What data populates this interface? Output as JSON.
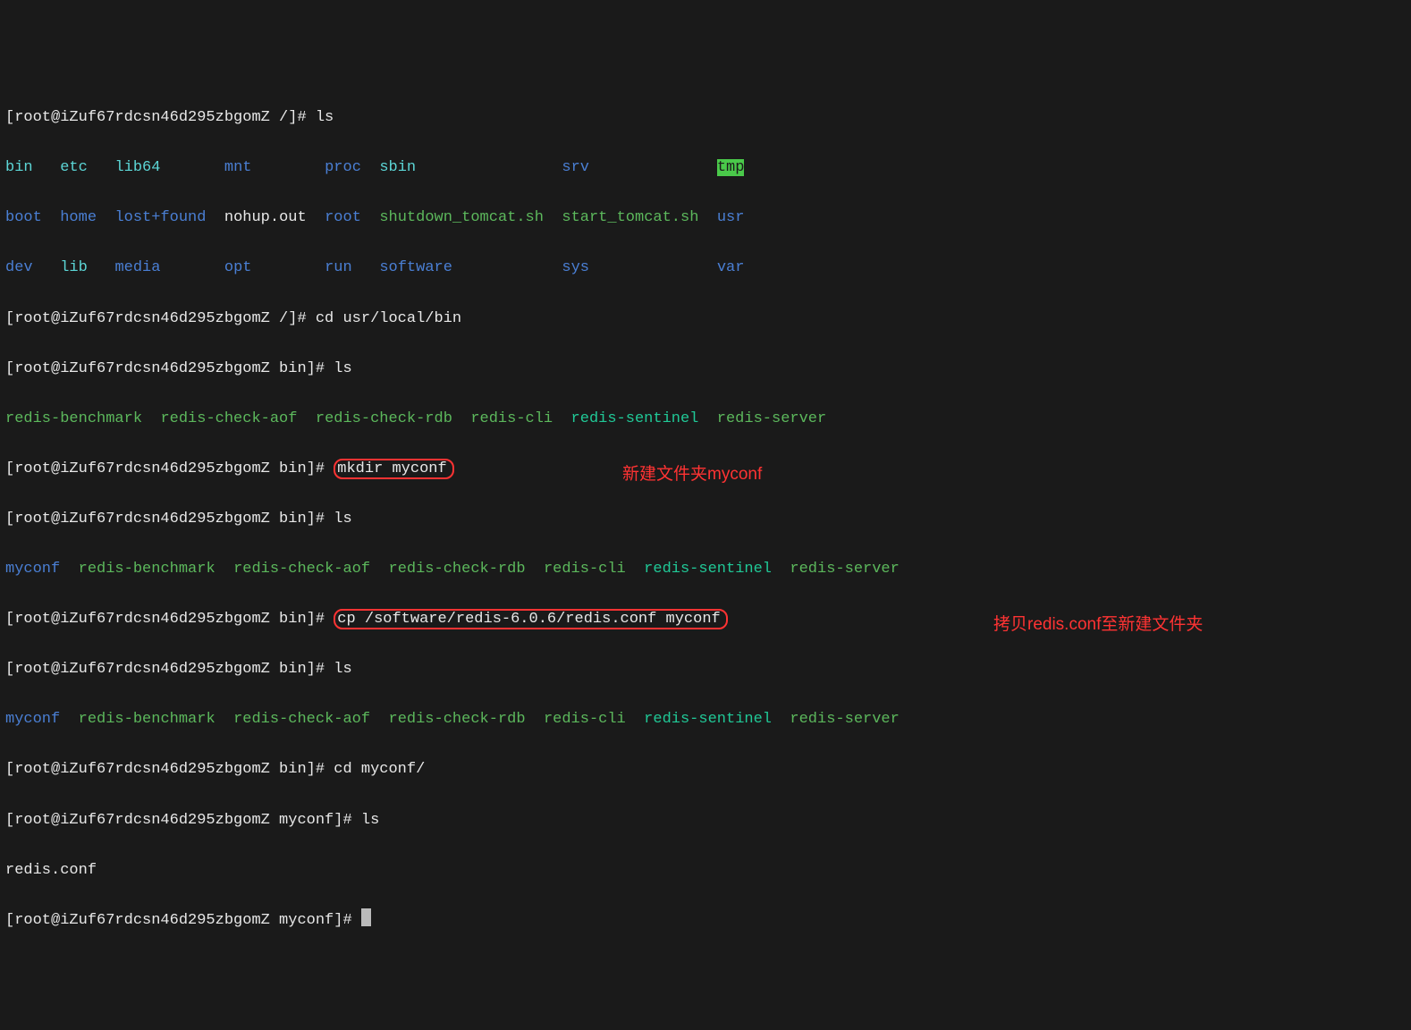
{
  "prompt_root_slash": "[root@iZuf67rdcsn46d295zbgomZ /]# ",
  "prompt_bin": "[root@iZuf67rdcsn46d295zbgomZ bin]# ",
  "prompt_myconf": "[root@iZuf67rdcsn46d295zbgomZ myconf]# ",
  "cmd_ls1": "ls",
  "cmd_cd_usr": "cd usr/local/bin",
  "cmd_ls2": "ls",
  "cmd_mkdir": "mkdir myconf",
  "cmd_ls3": "ls",
  "cmd_cp": "cp /software/redis-6.0.6/redis.conf myconf",
  "cmd_ls4": "ls",
  "cmd_cd_myconf": "cd myconf/",
  "cmd_ls5": "ls",
  "ls_root_row1": {
    "bin": "bin",
    "etc": "etc",
    "lib64": "lib64",
    "mnt": "mnt",
    "proc": "proc",
    "sbin": "sbin",
    "srv": "srv",
    "tmp": "tmp"
  },
  "ls_root_row2": {
    "boot": "boot",
    "home": "home",
    "lostfound": "lost+found",
    "nohup": "nohup.out",
    "root": "root",
    "shutdown": "shutdown_tomcat.sh",
    "start": "start_tomcat.sh",
    "usr": "usr"
  },
  "ls_root_row3": {
    "dev": "dev",
    "lib": "lib",
    "media": "media",
    "opt": "opt",
    "run": "run",
    "software": "software",
    "sys": "sys",
    "var": "var"
  },
  "bin_list": {
    "benchmark": "redis-benchmark",
    "checkaof": "redis-check-aof",
    "checkrdb": "redis-check-rdb",
    "cli": "redis-cli",
    "sentinel": "redis-sentinel",
    "server": "redis-server"
  },
  "myconf_dir": "myconf",
  "redis_conf": "redis.conf",
  "ann1": "新建文件夹myconf",
  "ann2": "拷贝redis.conf至新建文件夹"
}
